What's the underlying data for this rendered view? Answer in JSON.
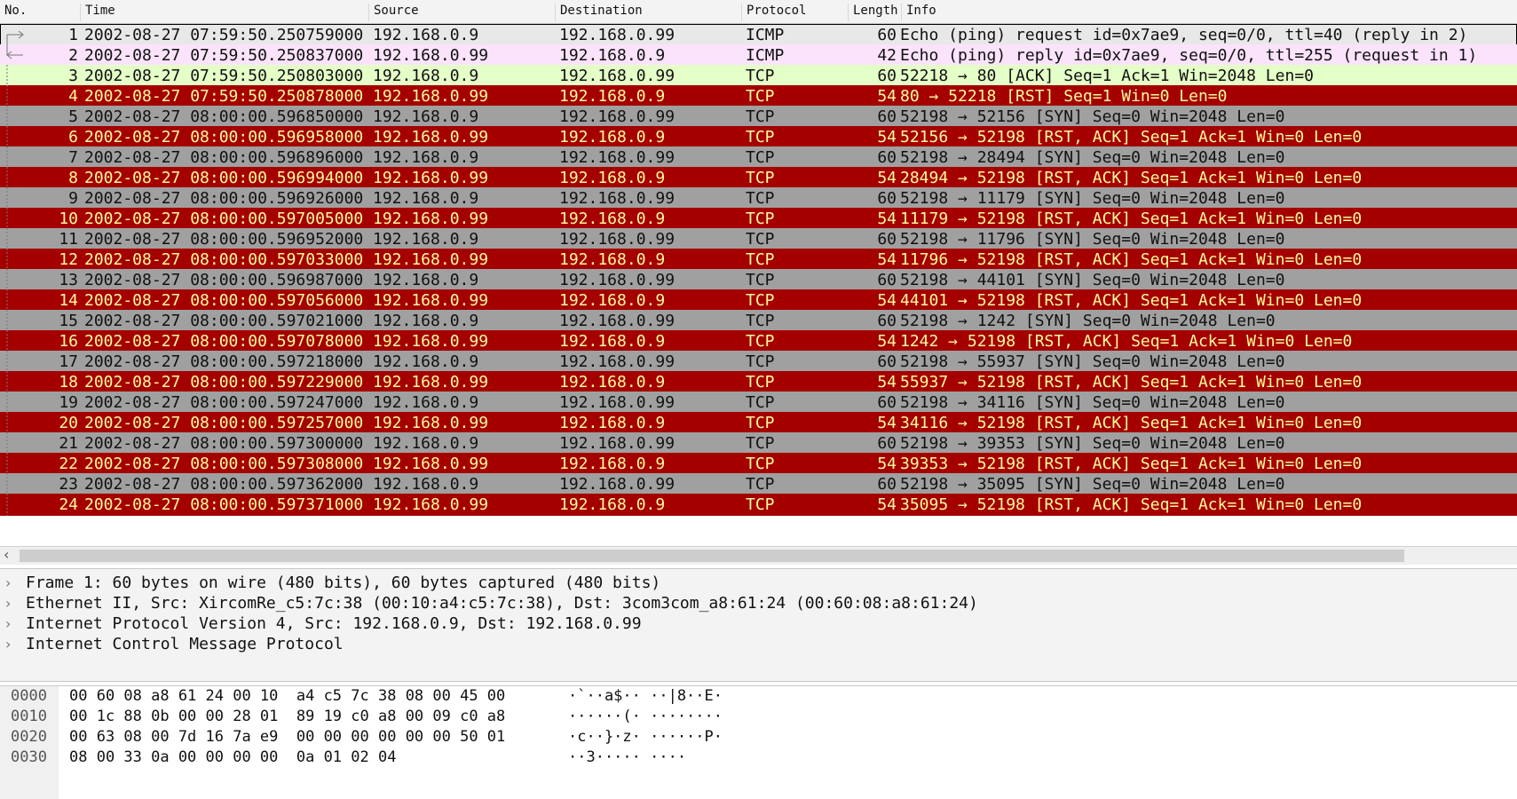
{
  "columns": {
    "no": "No.",
    "time": "Time",
    "source": "Source",
    "destination": "Destination",
    "protocol": "Protocol",
    "length": "Length",
    "info": "Info"
  },
  "colors": {
    "icmp_request_bg": "#e8e8e8",
    "icmp_reply_bg": "#fbe3fb",
    "tcp_ack_bg": "#e4ffc7",
    "tcp_rst_bg": "#a40000",
    "tcp_rst_fg": "#fffc9c",
    "tcp_syn_bg": "#a0a0a0",
    "selected_border": "#000000"
  },
  "packets": [
    {
      "no": "1",
      "time": "2002-08-27 07:59:50.250759000",
      "source": "192.168.0.9",
      "destination": "192.168.0.99",
      "protocol": "ICMP",
      "length": "60",
      "info": "Echo (ping) request  id=0x7ae9, seq=0/0, ttl=40 (reply in 2)",
      "kind": "icmp_req"
    },
    {
      "no": "2",
      "time": "2002-08-27 07:59:50.250837000",
      "source": "192.168.0.99",
      "destination": "192.168.0.9",
      "protocol": "ICMP",
      "length": "42",
      "info": "Echo (ping) reply    id=0x7ae9, seq=0/0, ttl=255 (request in 1)",
      "kind": "icmp_rep"
    },
    {
      "no": "3",
      "time": "2002-08-27 07:59:50.250803000",
      "source": "192.168.0.9",
      "destination": "192.168.0.99",
      "protocol": "TCP",
      "length": "60",
      "info": "52218 → 80 [ACK] Seq=1 Ack=1 Win=2048 Len=0",
      "kind": "ack"
    },
    {
      "no": "4",
      "time": "2002-08-27 07:59:50.250878000",
      "source": "192.168.0.99",
      "destination": "192.168.0.9",
      "protocol": "TCP",
      "length": "54",
      "info": "80 → 52218 [RST] Seq=1 Win=0 Len=0",
      "kind": "rst"
    },
    {
      "no": "5",
      "time": "2002-08-27 08:00:00.596850000",
      "source": "192.168.0.9",
      "destination": "192.168.0.99",
      "protocol": "TCP",
      "length": "60",
      "info": "52198 → 52156 [SYN] Seq=0 Win=2048 Len=0",
      "kind": "syn"
    },
    {
      "no": "6",
      "time": "2002-08-27 08:00:00.596958000",
      "source": "192.168.0.99",
      "destination": "192.168.0.9",
      "protocol": "TCP",
      "length": "54",
      "info": "52156 → 52198 [RST, ACK] Seq=1 Ack=1 Win=0 Len=0",
      "kind": "rst"
    },
    {
      "no": "7",
      "time": "2002-08-27 08:00:00.596896000",
      "source": "192.168.0.9",
      "destination": "192.168.0.99",
      "protocol": "TCP",
      "length": "60",
      "info": "52198 → 28494 [SYN] Seq=0 Win=2048 Len=0",
      "kind": "syn"
    },
    {
      "no": "8",
      "time": "2002-08-27 08:00:00.596994000",
      "source": "192.168.0.99",
      "destination": "192.168.0.9",
      "protocol": "TCP",
      "length": "54",
      "info": "28494 → 52198 [RST, ACK] Seq=1 Ack=1 Win=0 Len=0",
      "kind": "rst"
    },
    {
      "no": "9",
      "time": "2002-08-27 08:00:00.596926000",
      "source": "192.168.0.9",
      "destination": "192.168.0.99",
      "protocol": "TCP",
      "length": "60",
      "info": "52198 → 11179 [SYN] Seq=0 Win=2048 Len=0",
      "kind": "syn"
    },
    {
      "no": "10",
      "time": "2002-08-27 08:00:00.597005000",
      "source": "192.168.0.99",
      "destination": "192.168.0.9",
      "protocol": "TCP",
      "length": "54",
      "info": "11179 → 52198 [RST, ACK] Seq=1 Ack=1 Win=0 Len=0",
      "kind": "rst"
    },
    {
      "no": "11",
      "time": "2002-08-27 08:00:00.596952000",
      "source": "192.168.0.9",
      "destination": "192.168.0.99",
      "protocol": "TCP",
      "length": "60",
      "info": "52198 → 11796 [SYN] Seq=0 Win=2048 Len=0",
      "kind": "syn"
    },
    {
      "no": "12",
      "time": "2002-08-27 08:00:00.597033000",
      "source": "192.168.0.99",
      "destination": "192.168.0.9",
      "protocol": "TCP",
      "length": "54",
      "info": "11796 → 52198 [RST, ACK] Seq=1 Ack=1 Win=0 Len=0",
      "kind": "rst"
    },
    {
      "no": "13",
      "time": "2002-08-27 08:00:00.596987000",
      "source": "192.168.0.9",
      "destination": "192.168.0.99",
      "protocol": "TCP",
      "length": "60",
      "info": "52198 → 44101 [SYN] Seq=0 Win=2048 Len=0",
      "kind": "syn"
    },
    {
      "no": "14",
      "time": "2002-08-27 08:00:00.597056000",
      "source": "192.168.0.99",
      "destination": "192.168.0.9",
      "protocol": "TCP",
      "length": "54",
      "info": "44101 → 52198 [RST, ACK] Seq=1 Ack=1 Win=0 Len=0",
      "kind": "rst"
    },
    {
      "no": "15",
      "time": "2002-08-27 08:00:00.597021000",
      "source": "192.168.0.9",
      "destination": "192.168.0.99",
      "protocol": "TCP",
      "length": "60",
      "info": "52198 → 1242 [SYN] Seq=0 Win=2048 Len=0",
      "kind": "syn"
    },
    {
      "no": "16",
      "time": "2002-08-27 08:00:00.597078000",
      "source": "192.168.0.99",
      "destination": "192.168.0.9",
      "protocol": "TCP",
      "length": "54",
      "info": "1242 → 52198 [RST, ACK] Seq=1 Ack=1 Win=0 Len=0",
      "kind": "rst"
    },
    {
      "no": "17",
      "time": "2002-08-27 08:00:00.597218000",
      "source": "192.168.0.9",
      "destination": "192.168.0.99",
      "protocol": "TCP",
      "length": "60",
      "info": "52198 → 55937 [SYN] Seq=0 Win=2048 Len=0",
      "kind": "syn"
    },
    {
      "no": "18",
      "time": "2002-08-27 08:00:00.597229000",
      "source": "192.168.0.99",
      "destination": "192.168.0.9",
      "protocol": "TCP",
      "length": "54",
      "info": "55937 → 52198 [RST, ACK] Seq=1 Ack=1 Win=0 Len=0",
      "kind": "rst"
    },
    {
      "no": "19",
      "time": "2002-08-27 08:00:00.597247000",
      "source": "192.168.0.9",
      "destination": "192.168.0.99",
      "protocol": "TCP",
      "length": "60",
      "info": "52198 → 34116 [SYN] Seq=0 Win=2048 Len=0",
      "kind": "syn"
    },
    {
      "no": "20",
      "time": "2002-08-27 08:00:00.597257000",
      "source": "192.168.0.99",
      "destination": "192.168.0.9",
      "protocol": "TCP",
      "length": "54",
      "info": "34116 → 52198 [RST, ACK] Seq=1 Ack=1 Win=0 Len=0",
      "kind": "rst"
    },
    {
      "no": "21",
      "time": "2002-08-27 08:00:00.597300000",
      "source": "192.168.0.9",
      "destination": "192.168.0.99",
      "protocol": "TCP",
      "length": "60",
      "info": "52198 → 39353 [SYN] Seq=0 Win=2048 Len=0",
      "kind": "syn"
    },
    {
      "no": "22",
      "time": "2002-08-27 08:00:00.597308000",
      "source": "192.168.0.99",
      "destination": "192.168.0.9",
      "protocol": "TCP",
      "length": "54",
      "info": "39353 → 52198 [RST, ACK] Seq=1 Ack=1 Win=0 Len=0",
      "kind": "rst"
    },
    {
      "no": "23",
      "time": "2002-08-27 08:00:00.597362000",
      "source": "192.168.0.9",
      "destination": "192.168.0.99",
      "protocol": "TCP",
      "length": "60",
      "info": "52198 → 35095 [SYN] Seq=0 Win=2048 Len=0",
      "kind": "syn"
    },
    {
      "no": "24",
      "time": "2002-08-27 08:00:00.597371000",
      "source": "192.168.0.99",
      "destination": "192.168.0.9",
      "protocol": "TCP",
      "length": "54",
      "info": "35095 → 52198 [RST, ACK] Seq=1 Ack=1 Win=0 Len=0",
      "kind": "rst"
    }
  ],
  "details": [
    "Frame 1: 60 bytes on wire (480 bits), 60 bytes captured (480 bits)",
    "Ethernet II, Src: XircomRe_c5:7c:38 (00:10:a4:c5:7c:38), Dst: 3com3com_a8:61:24 (00:60:08:a8:61:24)",
    "Internet Protocol Version 4, Src: 192.168.0.9, Dst: 192.168.0.99",
    "Internet Control Message Protocol"
  ],
  "hexdump": [
    {
      "offset": "0000",
      "bytes": "00 60 08 a8 61 24 00 10  a4 c5 7c 38 08 00 45 00",
      "ascii": "·`··a$·· ··|8··E·"
    },
    {
      "offset": "0010",
      "bytes": "00 1c 88 0b 00 00 28 01  89 19 c0 a8 00 09 c0 a8",
      "ascii": "······(· ········"
    },
    {
      "offset": "0020",
      "bytes": "00 63 08 00 7d 16 7a e9  00 00 00 00 00 00 50 01",
      "ascii": "·c··}·z· ······P·"
    },
    {
      "offset": "0030",
      "bytes": "08 00 33 0a 00 00 00 00  0a 01 02 04",
      "ascii": "··3····· ····"
    }
  ]
}
